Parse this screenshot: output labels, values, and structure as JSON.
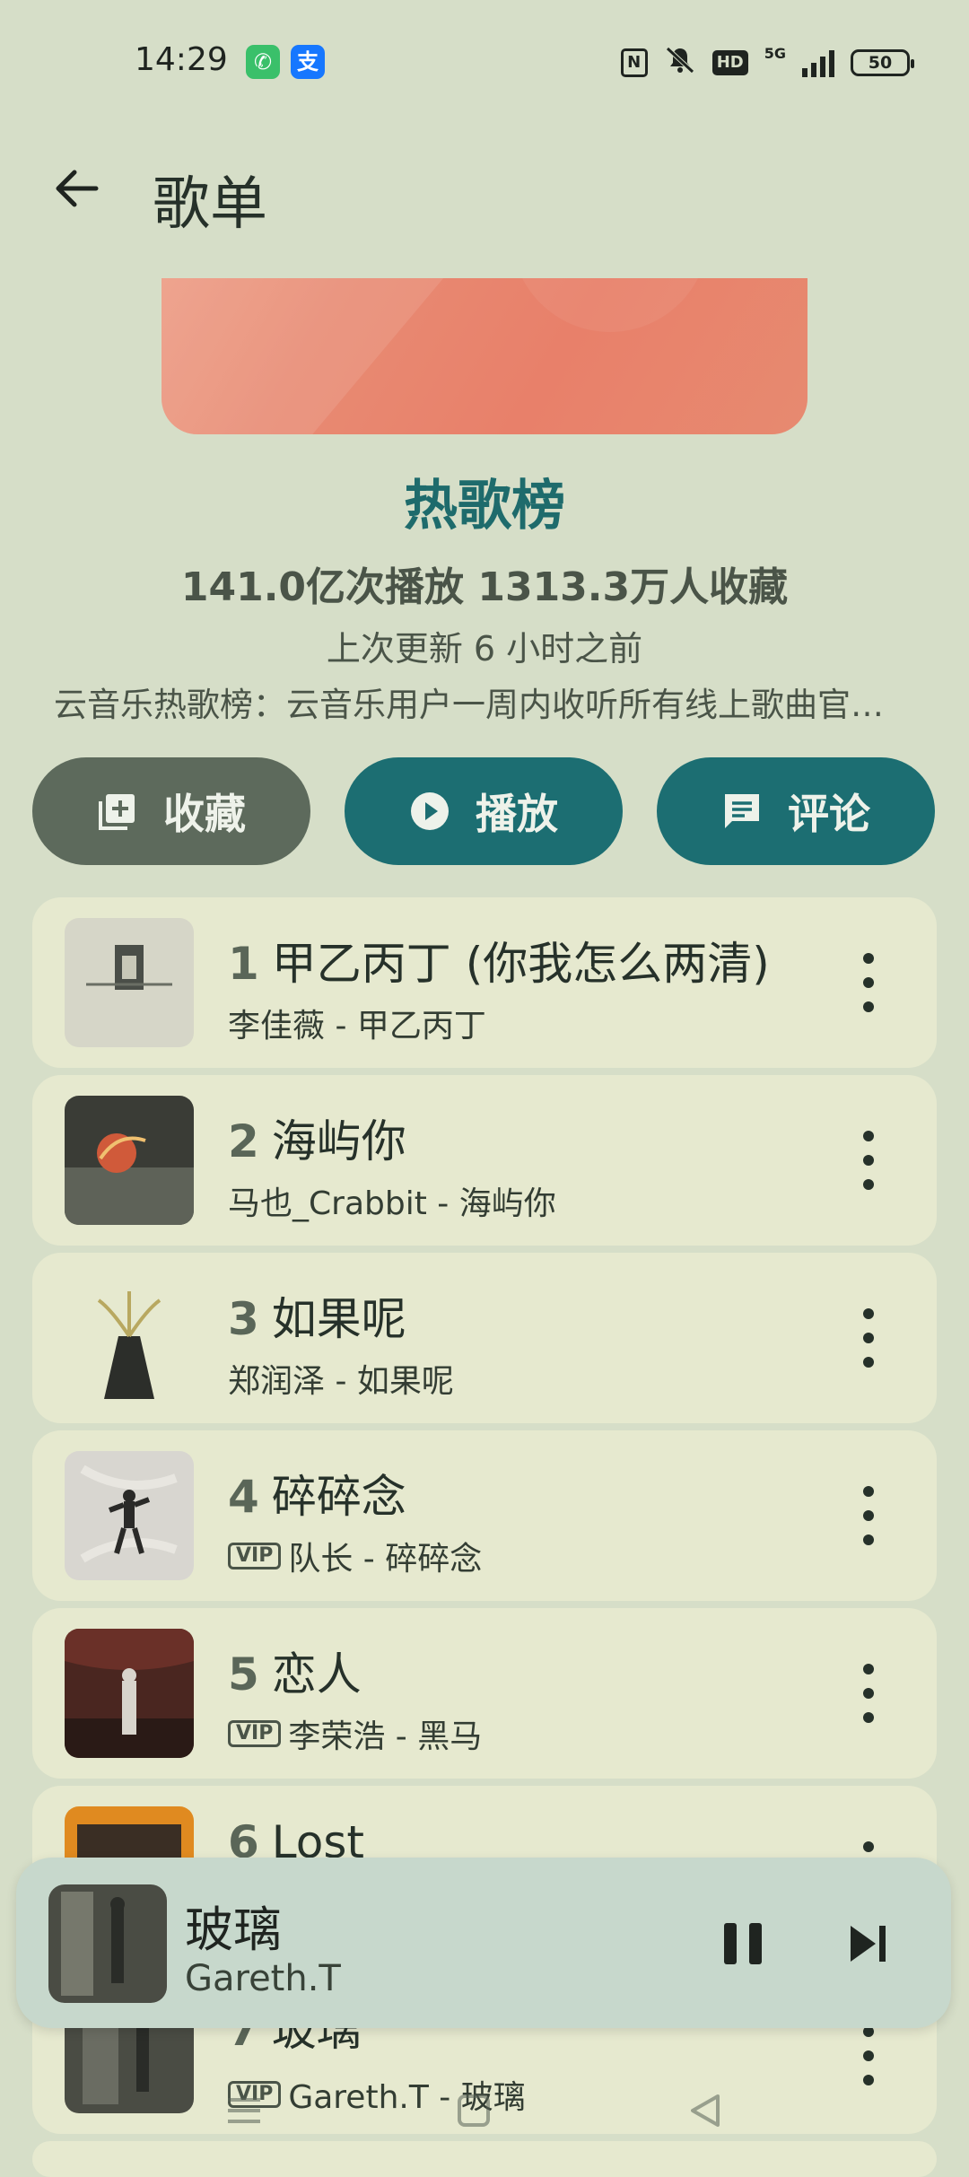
{
  "status_bar": {
    "time": "14:29",
    "battery": "50",
    "network": "5G",
    "hd_label": "HD",
    "nfc_label": "N",
    "icons": [
      "phone-app-icon",
      "alipay-app-icon",
      "nfc-icon",
      "mute-icon",
      "hd-icon",
      "signal-icon",
      "battery-icon"
    ],
    "alipay_glyph": "支"
  },
  "header": {
    "back_icon": "arrow-left-icon",
    "title": "歌单"
  },
  "playlist": {
    "name": "热歌榜",
    "stats": "141.0亿次播放  1313.3万人收藏",
    "updated": "上次更新 6 小时之前",
    "description": "云音乐热歌榜：云音乐用户一周内收听所有线上歌曲官方TOP排行榜，每日更新。"
  },
  "actions": {
    "favorite": "收藏",
    "play": "播放",
    "comment": "评论"
  },
  "songs": [
    {
      "rank": "1",
      "title": "甲乙丙丁 (你我怎么两清)",
      "subtitle": "李佳薇 - 甲乙丙丁",
      "vip": false
    },
    {
      "rank": "2",
      "title": "海屿你",
      "subtitle": "马也_Crabbit - 海屿你",
      "vip": false
    },
    {
      "rank": "3",
      "title": "如果呢",
      "subtitle": "郑润泽 - 如果呢",
      "vip": false
    },
    {
      "rank": "4",
      "title": "碎碎念",
      "subtitle": "队长 - 碎碎念",
      "vip": true
    },
    {
      "rank": "5",
      "title": "恋人",
      "subtitle": "李荣浩 - 黑马",
      "vip": true
    },
    {
      "rank": "6",
      "title": "Lost",
      "subtitle": "",
      "vip": false
    },
    {
      "rank": "7",
      "title": "玻璃",
      "subtitle": "Gareth.T - 玻璃",
      "vip": true
    }
  ],
  "vip_label": "VIP",
  "now_playing": {
    "title": "玻璃",
    "artist": "Gareth.T"
  },
  "colors": {
    "background": "#d6dec8",
    "accent": "#1c6e72",
    "card": "#e6e9cf",
    "mini_player": "#c7d8cc"
  }
}
